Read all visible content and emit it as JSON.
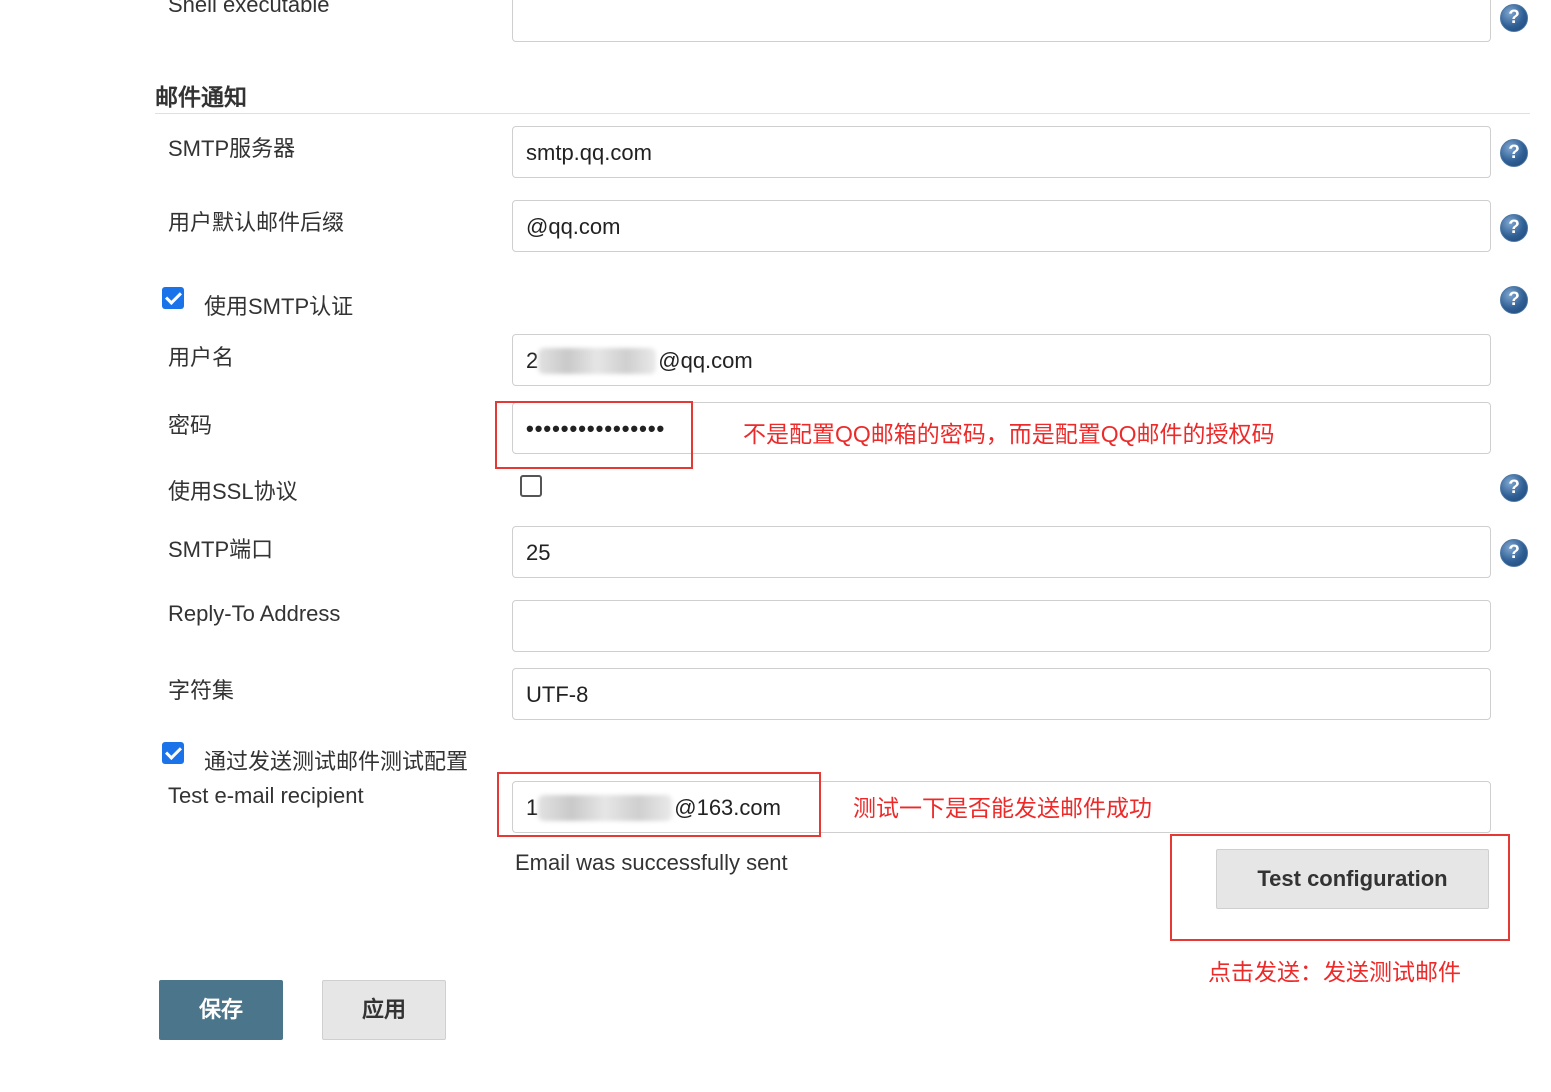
{
  "top_partial": {
    "label": "Shell executable"
  },
  "section": {
    "title": "邮件通知"
  },
  "smtp_server": {
    "label": "SMTP服务器",
    "value": "smtp.qq.com"
  },
  "default_suffix": {
    "label": "用户默认邮件后缀",
    "value": "@qq.com"
  },
  "use_smtp_auth": {
    "label": "使用SMTP认证",
    "checked": true
  },
  "username": {
    "label": "用户名",
    "value_prefix": "2",
    "value_suffix": "@qq.com"
  },
  "password": {
    "label": "密码",
    "value": "••••••••••••••••"
  },
  "use_ssl": {
    "label": "使用SSL协议",
    "checked": false
  },
  "smtp_port": {
    "label": "SMTP端口",
    "value": "25"
  },
  "reply_to": {
    "label": "Reply-To Address",
    "value": ""
  },
  "charset": {
    "label": "字符集",
    "value": "UTF-8"
  },
  "test_config": {
    "label": "通过发送测试邮件测试配置",
    "checked": true
  },
  "test_recipient": {
    "label": "Test e-mail recipient",
    "value_prefix": "1",
    "value_suffix": "@163.com"
  },
  "status": {
    "message": "Email was successfully sent"
  },
  "buttons": {
    "test": "Test configuration",
    "save": "保存",
    "apply": "应用"
  },
  "annotations": {
    "password_note": "不是配置QQ邮箱的密码，而是配置QQ邮件的授权码",
    "test_note": "测试一下是否能发送邮件成功",
    "send_note": "点击发送：发送测试邮件"
  },
  "icons": {
    "help": "help-icon",
    "checkbox": "checkbox-icon"
  },
  "colors": {
    "annotation": "#e53935",
    "save_button": "#4b758b",
    "checkbox": "#1a73e8",
    "help": "#2f5f95"
  }
}
